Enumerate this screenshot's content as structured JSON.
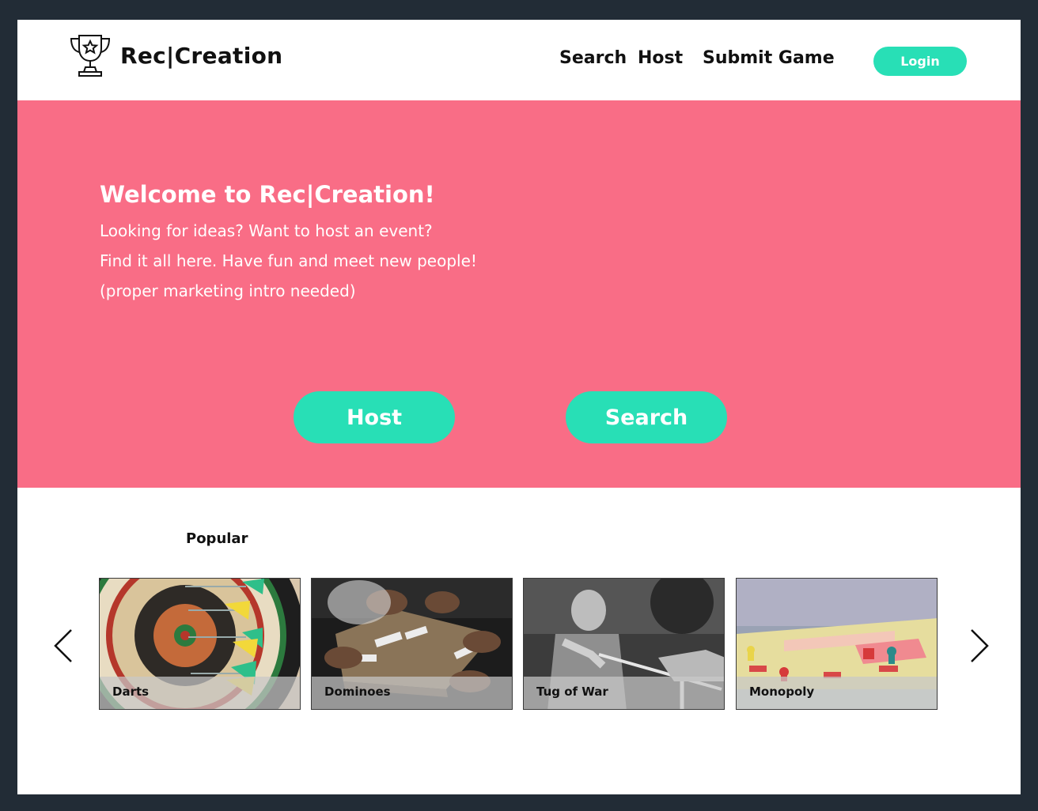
{
  "header": {
    "brand": "Rec|Creation",
    "logo_icon": "trophy-icon",
    "nav": [
      {
        "label": "Search"
      },
      {
        "label": "Host"
      },
      {
        "label": "Submit Game"
      }
    ],
    "login_label": "Login"
  },
  "hero": {
    "title": "Welcome to Rec|Creation!",
    "lines": [
      "Looking for ideas? Want to host an event?",
      "Find it all here. Have fun and meet new people!",
      "(proper marketing intro needed)"
    ],
    "host_label": "Host",
    "search_label": "Search",
    "background_color": "#f96d86",
    "accent_color": "#28dfb6"
  },
  "popular": {
    "title": "Popular",
    "prev_icon": "chevron-left-icon",
    "next_icon": "chevron-right-icon",
    "cards": [
      {
        "label": "Darts"
      },
      {
        "label": "Dominoes"
      },
      {
        "label": "Tug of War"
      },
      {
        "label": "Monopoly"
      }
    ]
  }
}
